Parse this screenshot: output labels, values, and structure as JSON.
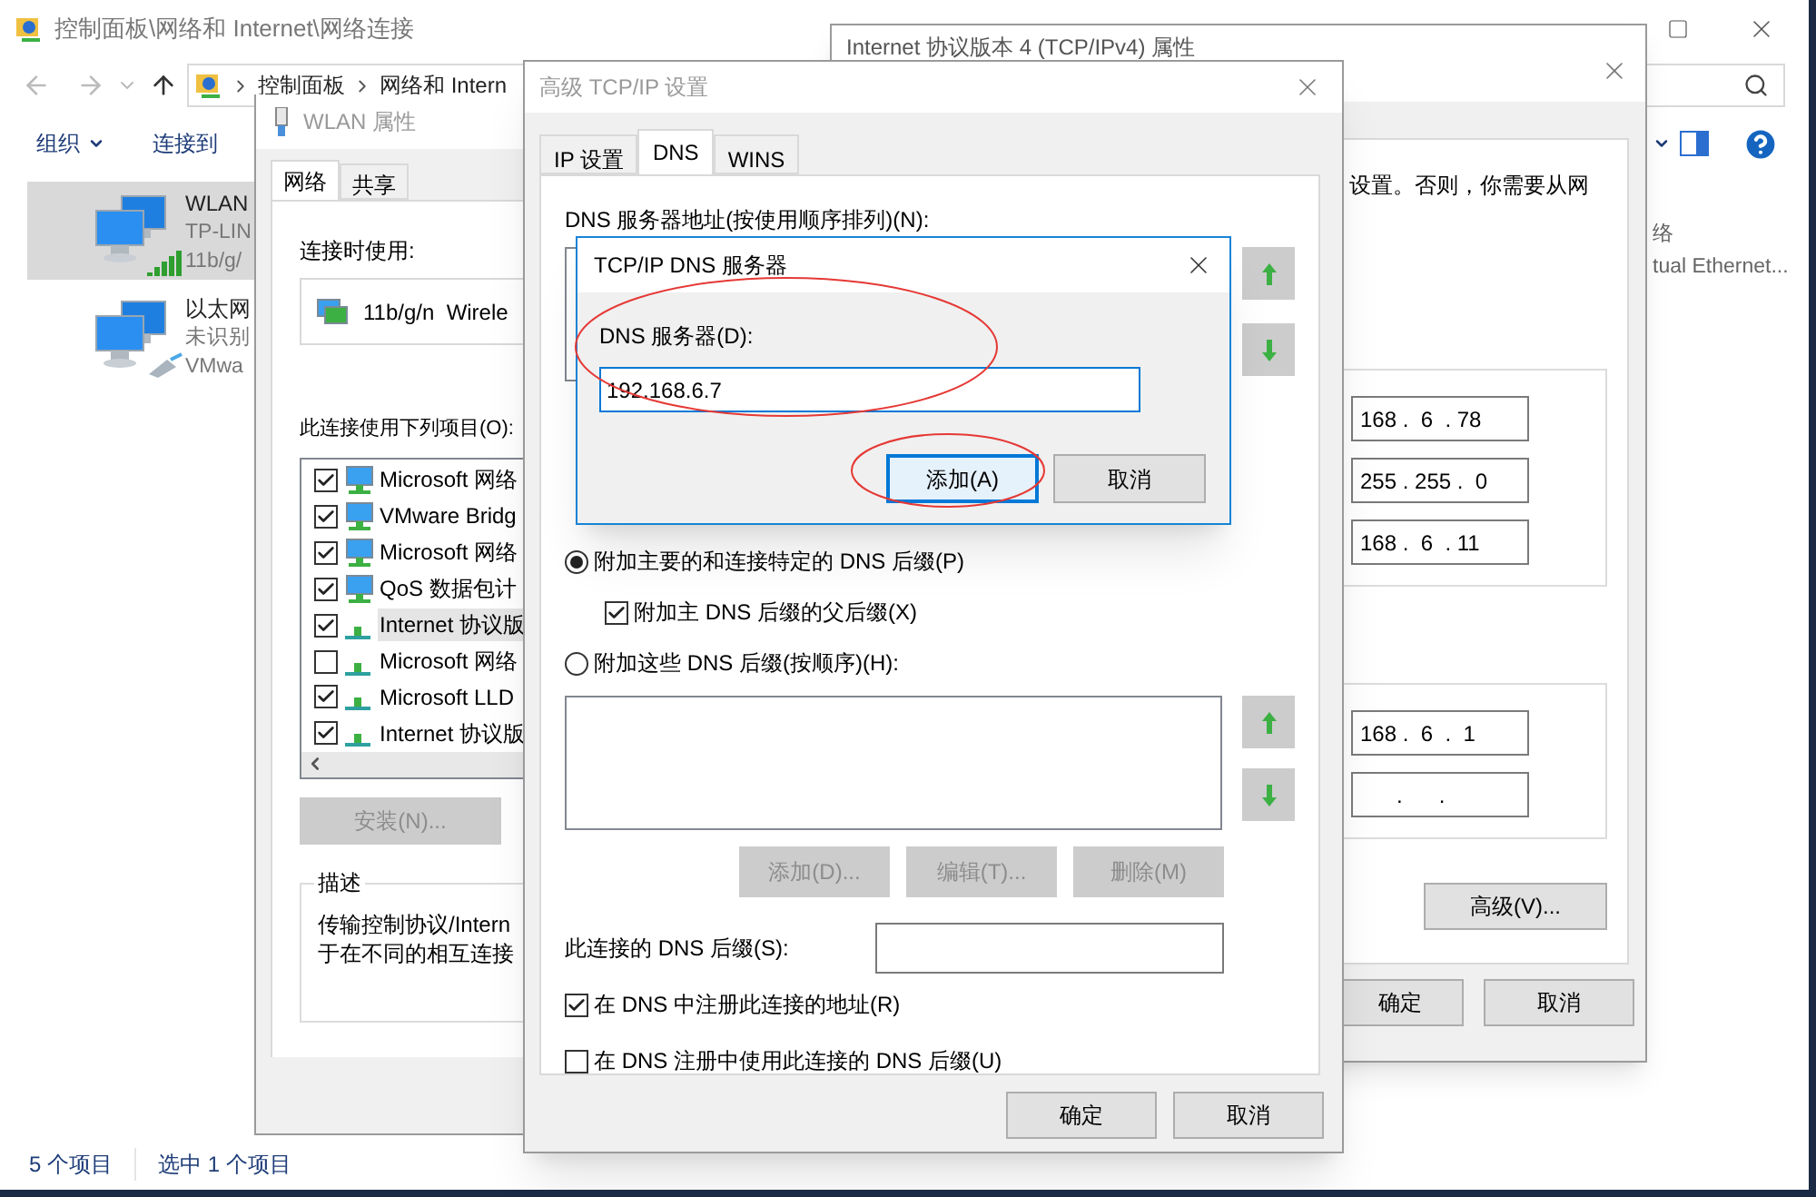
{
  "explorer": {
    "title": "控制面板\\网络和 Internet\\网络连接",
    "breadcrumb": [
      "控制面板",
      "网络和 Intern"
    ],
    "toolbar": [
      {
        "label": "组织",
        "dropdown": true
      },
      {
        "label": "连接到",
        "dropdown": false
      }
    ],
    "connections": [
      {
        "name": "WLAN",
        "lines": [
          "TP-LIN",
          "11b/g/"
        ],
        "kind": "wifi",
        "selected": true
      },
      {
        "name": "以太网",
        "lines": [
          "未识别",
          "VMwa"
        ],
        "kind": "ethernet",
        "selected": false
      }
    ],
    "partial_item_lines": [
      "络",
      "tual Ethernet..."
    ],
    "status": [
      "5 个项目",
      "选中 1 个项目"
    ]
  },
  "ipv4_window": {
    "title": "Internet 协议版本 4 (TCP/IPv4) 属性",
    "text": "设置。否则，你需要从网",
    "ip_fields": [
      "168 .  6  . 78",
      "255 . 255 .  0",
      "168 .  6  . 11"
    ],
    "dns_fields": [
      "168 .  6  .  1",
      "      .      ."
    ],
    "advanced_button": "高级(V)...",
    "buttons": [
      "确定",
      "取消"
    ]
  },
  "wlan_window": {
    "title": "WLAN 属性",
    "tabs": [
      {
        "label": "网络",
        "selected": true
      },
      {
        "label": "共享",
        "selected": false
      }
    ],
    "connect_using_label": "连接时使用:",
    "adapter": "11b/g/n  Wirele",
    "items_label": "此连接使用下列项目(O):",
    "items": [
      {
        "label": "Microsoft 网络",
        "checked": true,
        "kind": "service",
        "selected": false
      },
      {
        "label": "VMware Bridg",
        "checked": true,
        "kind": "service",
        "selected": false
      },
      {
        "label": "Microsoft 网络",
        "checked": true,
        "kind": "service",
        "selected": false
      },
      {
        "label": "QoS 数据包计",
        "checked": true,
        "kind": "service",
        "selected": false
      },
      {
        "label": "Internet 协议版",
        "checked": true,
        "kind": "protocol",
        "selected": true
      },
      {
        "label": "Microsoft 网络",
        "checked": false,
        "kind": "protocol",
        "selected": false
      },
      {
        "label": "Microsoft LLD",
        "checked": true,
        "kind": "protocol",
        "selected": false
      },
      {
        "label": "Internet 协议版",
        "checked": true,
        "kind": "protocol",
        "selected": false
      }
    ],
    "install_button": {
      "label": "安装(N)...",
      "disabled": true
    },
    "description": {
      "title": "描述",
      "lines": [
        "传输控制协议/Intern",
        "于在不同的相互连接"
      ]
    }
  },
  "advanced_dialog": {
    "title": "高级 TCP/IP 设置",
    "tabs": [
      {
        "label": "IP 设置",
        "selected": false
      },
      {
        "label": "DNS",
        "selected": true
      },
      {
        "label": "WINS",
        "selected": false
      }
    ],
    "servers_label": "DNS 服务器地址(按使用顺序排列)(N):",
    "suffix_options": [
      {
        "kind": "radio",
        "label": "附加主要的和连接特定的 DNS 后缀(P)",
        "selected": true
      },
      {
        "kind": "checkbox",
        "label": "附加主 DNS 后缀的父后缀(X)",
        "checked": true
      },
      {
        "kind": "radio",
        "label": "附加这些 DNS 后缀(按顺序)(H):",
        "selected": false
      }
    ],
    "list_buttons": [
      {
        "label": "添加(D)...",
        "disabled": true
      },
      {
        "label": "编辑(T)...",
        "disabled": true
      },
      {
        "label": "删除(M)",
        "disabled": true
      }
    ],
    "suffix_label": "此连接的 DNS 后缀(S):",
    "register_options": [
      {
        "label": "在 DNS 中注册此连接的地址(R)",
        "checked": true
      },
      {
        "label": "在 DNS 注册中使用此连接的 DNS 后缀(U)",
        "checked": false
      }
    ],
    "buttons": [
      "确定",
      "取消"
    ]
  },
  "dns_server_dialog": {
    "title": "TCP/IP DNS 服务器",
    "field_label": "DNS 服务器(D):",
    "value": "192.168.6.7",
    "buttons": [
      {
        "label": "添加(A)",
        "focused": true
      },
      {
        "label": "取消",
        "focused": false
      }
    ]
  }
}
